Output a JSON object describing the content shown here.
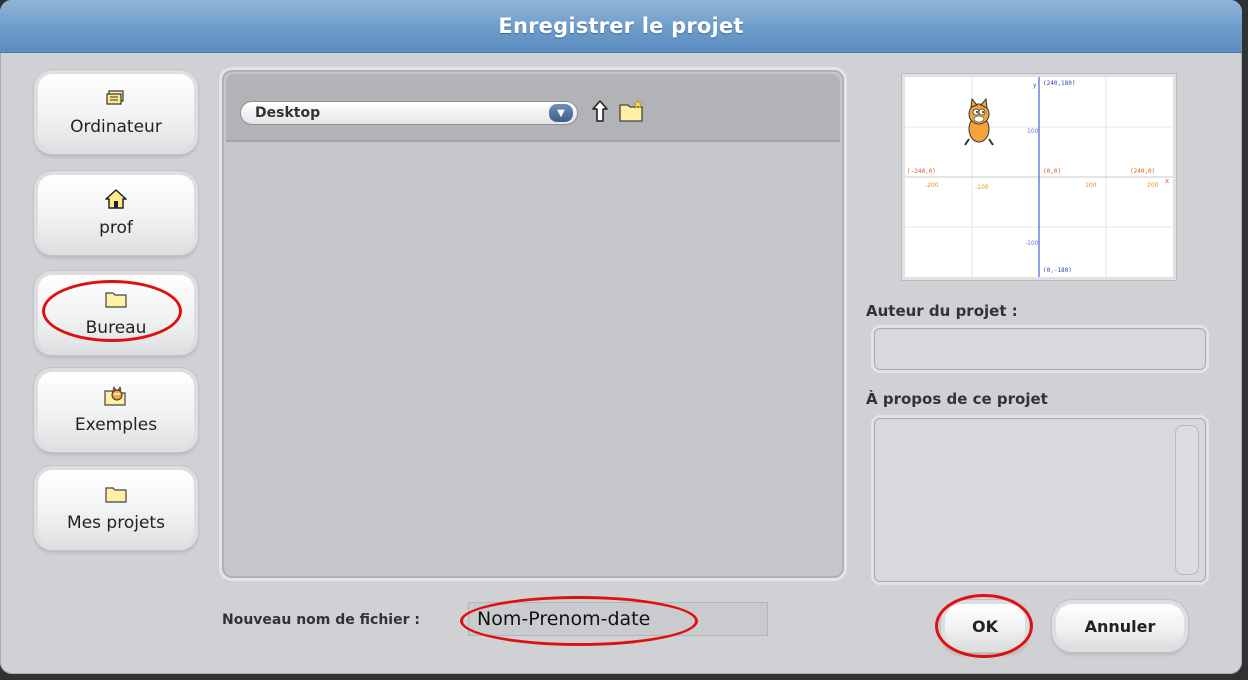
{
  "dialog": {
    "title": "Enregistrer le projet"
  },
  "locations": [
    {
      "label": "Ordinateur",
      "icon": "computer-icon"
    },
    {
      "label": "prof",
      "icon": "home-icon"
    },
    {
      "label": "Bureau",
      "icon": "folder-icon"
    },
    {
      "label": "Exemples",
      "icon": "scratch-examples-icon"
    },
    {
      "label": "Mes projets",
      "icon": "folder-icon"
    }
  ],
  "file_browser": {
    "current_folder": "Desktop",
    "up_icon": "folder-up-icon",
    "new_folder_icon": "new-folder-icon"
  },
  "filename": {
    "label": "Nouveau nom de fichier :",
    "value": "Nom-Prenom-date"
  },
  "project_info": {
    "author_label": "Auteur du projet :",
    "author_value": "",
    "about_label": "À propos de ce projet",
    "about_value": ""
  },
  "stage_preview": {
    "top_label": "(240,180)",
    "left_label": "(-240,0)",
    "center_label": "(0,0)",
    "right_label": "(240,0)",
    "bottom_label": "(0,-180)"
  },
  "buttons": {
    "ok_label": "OK",
    "cancel_label": "Annuler"
  },
  "annotation_color": "#e01010"
}
